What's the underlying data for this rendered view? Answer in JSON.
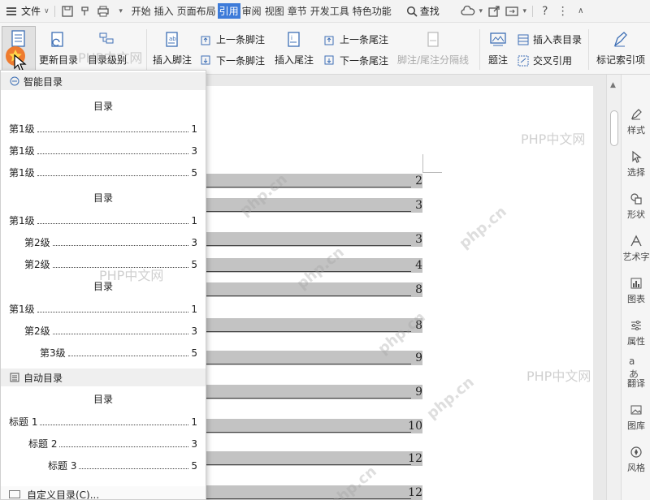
{
  "menubar": {
    "file_label": "文件",
    "tabs": [
      "开始",
      "插入",
      "页面布局",
      "引用",
      "审阅",
      "视图",
      "章节",
      "开发工具",
      "特色功能"
    ],
    "active_tab": "引用",
    "search_label": "查找"
  },
  "ribbon": {
    "update_toc": "更新目录",
    "toc_level": "目录级别",
    "insert_footnote": "插入脚注",
    "prev_footnote": "上一条脚注",
    "next_footnote": "下一条脚注",
    "insert_endnote": "插入尾注",
    "prev_endnote": "上一条尾注",
    "next_endnote": "下一条尾注",
    "separator_line": "脚注/尾注分隔线",
    "caption": "题注",
    "insert_table_toc": "插入表目录",
    "cross_ref": "交叉引用",
    "mark_index": "标记索引项"
  },
  "dropdown": {
    "smart_toc_header": "智能目录",
    "toc_title": "目录",
    "block1": [
      {
        "label": "第1级",
        "page": "1"
      },
      {
        "label": "第1级",
        "page": "3"
      },
      {
        "label": "第1级",
        "page": "5"
      }
    ],
    "block2": [
      {
        "label": "第1级",
        "page": "1"
      },
      {
        "label": "第2级",
        "page": "3"
      },
      {
        "label": "第2级",
        "page": "5"
      }
    ],
    "block3": [
      {
        "label": "第1级",
        "page": "1"
      },
      {
        "label": "第2级",
        "page": "3"
      },
      {
        "label": "第3级",
        "page": "5"
      }
    ],
    "auto_toc_header": "自动目录",
    "block4": [
      {
        "label": "标题 1",
        "page": "1"
      },
      {
        "label": "标题 2",
        "page": "3"
      },
      {
        "label": "标题 3",
        "page": "5"
      }
    ],
    "custom_toc": "自定义目录(C)..."
  },
  "document": {
    "toc_page_numbers": [
      "2",
      "3",
      "3",
      "4",
      "8",
      "8",
      "9",
      "9",
      "10",
      "12",
      "12"
    ]
  },
  "right_sidebar": [
    "样式",
    "选择",
    "形状",
    "艺术字",
    "图表",
    "属性",
    "翻译",
    "图库",
    "风格"
  ],
  "watermarks": {
    "text": "PHP中文网",
    "diag": "php.cn"
  }
}
